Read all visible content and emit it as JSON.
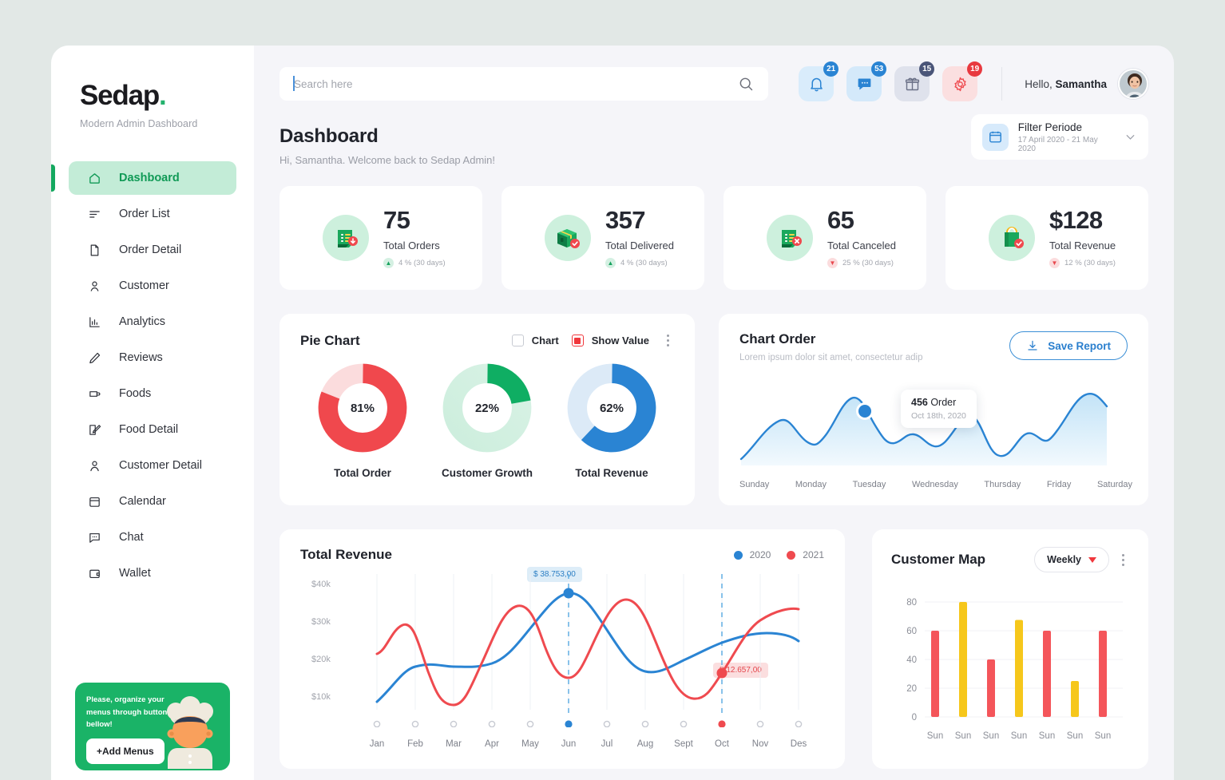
{
  "brand": {
    "name": "Sedap",
    "dot": ".",
    "subtitle": "Modern Admin Dashboard"
  },
  "sidebar": {
    "items": [
      {
        "label": "Dashboard",
        "icon": "home-icon",
        "active": true
      },
      {
        "label": "Order List",
        "icon": "list-icon",
        "active": false
      },
      {
        "label": "Order Detail",
        "icon": "file-icon",
        "active": false
      },
      {
        "label": "Customer",
        "icon": "user-icon",
        "active": false
      },
      {
        "label": "Analytics",
        "icon": "bar-chart-icon",
        "active": false
      },
      {
        "label": "Reviews",
        "icon": "pencil-icon",
        "active": false
      },
      {
        "label": "Foods",
        "icon": "cup-icon",
        "active": false
      },
      {
        "label": "Food Detail",
        "icon": "edit-square-icon",
        "active": false
      },
      {
        "label": "Customer Detail",
        "icon": "person-icon",
        "active": false
      },
      {
        "label": "Calendar",
        "icon": "calendar-icon",
        "active": false
      },
      {
        "label": "Chat",
        "icon": "chat-icon",
        "active": false
      },
      {
        "label": "Wallet",
        "icon": "wallet-icon",
        "active": false
      }
    ],
    "promo": {
      "text": "Please, organize your menus through button bellow!",
      "button": "+Add Menus"
    }
  },
  "topbar": {
    "search": {
      "placeholder": "Search here",
      "value": ""
    },
    "icons": [
      {
        "name": "bell-icon",
        "badge": "21"
      },
      {
        "name": "message-icon",
        "badge": "53"
      },
      {
        "name": "gift-icon",
        "badge": "15"
      },
      {
        "name": "gear-icon",
        "badge": "19"
      }
    ],
    "greeting_prefix": "Hello, ",
    "greeting_name": "Samantha"
  },
  "page": {
    "title": "Dashboard",
    "subtitle": "Hi, Samantha. Welcome back  to Sedap Admin!",
    "filter": {
      "label": "Filter Periode",
      "range": "17 April 2020 - 21 May 2020"
    }
  },
  "stats": [
    {
      "value": "75",
      "label": "Total Orders",
      "delta": "4 % (30 days)",
      "dir": "up",
      "icon": "order-doc-icon"
    },
    {
      "value": "357",
      "label": "Total Delivered",
      "delta": "4 % (30 days)",
      "dir": "up",
      "icon": "box-check-icon"
    },
    {
      "value": "65",
      "label": "Total Canceled",
      "delta": "25 % (30 days)",
      "dir": "down",
      "icon": "order-cancel-icon"
    },
    {
      "value": "$128",
      "label": "Total Revenue",
      "delta": "12 % (30 days)",
      "dir": "down",
      "icon": "bag-check-icon"
    }
  ],
  "pie_card": {
    "title": "Pie Chart",
    "controls": [
      {
        "label": "Chart",
        "checked": false
      },
      {
        "label": "Show Value",
        "checked": true
      }
    ]
  },
  "order_card": {
    "title": "Chart Order",
    "subtitle": "Lorem ipsum dolor sit amet, consectetur adip",
    "save_label": "Save Report",
    "tooltip": {
      "value": "456",
      "unit": " Order",
      "date": "Oct 18th, 2020"
    }
  },
  "revenue_card": {
    "title": "Total Revenue",
    "legend": [
      {
        "label": "2020",
        "color": "#2a84d3"
      },
      {
        "label": "2021",
        "color": "#ef4a4f"
      }
    ],
    "tooltip_blue": "$ 38.753,00",
    "tooltip_red": "$ 12.657,00"
  },
  "map_card": {
    "title": "Customer Map",
    "period": "Weekly"
  },
  "chart_data": [
    {
      "type": "pie",
      "title": "Pie Chart",
      "donuts": [
        {
          "label": "Total Order",
          "value": 81,
          "color": "#f0484d",
          "track": "#fbdcdd"
        },
        {
          "label": "Customer Growth",
          "value": 22,
          "color": "#0fae63",
          "track": "#d2efe0"
        },
        {
          "label": "Total Revenue",
          "value": 62,
          "color": "#2a84d3",
          "track": "#dceaf7"
        }
      ]
    },
    {
      "type": "area",
      "title": "Chart Order",
      "categories": [
        "Sunday",
        "Monday",
        "Tuesday",
        "Wednesday",
        "Thursday",
        "Friday",
        "Saturday"
      ],
      "values": [
        120,
        300,
        456,
        210,
        330,
        250,
        430
      ],
      "series": [
        {
          "name": "Orders",
          "values": [
            120,
            300,
            456,
            210,
            330,
            250,
            430
          ]
        }
      ],
      "xlabel": "",
      "ylabel": "",
      "annotation": {
        "x": "Tuesday",
        "value": 456,
        "text": "456 Order",
        "date": "Oct 18th, 2020"
      },
      "grid": false,
      "legend": "none"
    },
    {
      "type": "line",
      "title": "Total Revenue",
      "categories": [
        "Jan",
        "Feb",
        "Mar",
        "Apr",
        "May",
        "Jun",
        "Jul",
        "Aug",
        "Sept",
        "Oct",
        "Nov",
        "Des"
      ],
      "series": [
        {
          "name": "2020",
          "color": "#2a84d3",
          "values": [
            10000,
            17500,
            19000,
            18500,
            26000,
            38753,
            31000,
            20500,
            19500,
            22500,
            25500,
            25000
          ]
        },
        {
          "name": "2021",
          "color": "#ef4a4f",
          "values": [
            21000,
            29500,
            10000,
            24000,
            36000,
            19500,
            28000,
            38500,
            26000,
            12657,
            30500,
            38000
          ]
        }
      ],
      "ytick_labels": [
        "$40k",
        "$30k",
        "$20k",
        "$10k"
      ],
      "ylim": [
        0,
        45000
      ],
      "xlabel": "",
      "ylabel": "",
      "annotations": [
        {
          "series": "2020",
          "x": "Jun",
          "value": 38753,
          "text": "$ 38.753,00"
        },
        {
          "series": "2021",
          "x": "Oct",
          "value": 12657,
          "text": "$ 12.657,00"
        }
      ],
      "grid": true,
      "legend": "top-right"
    },
    {
      "type": "bar",
      "title": "Customer Map",
      "categories": [
        "Sun",
        "Sun",
        "Sun",
        "Sun",
        "Sun",
        "Sun",
        "Sun"
      ],
      "values": [
        60,
        80,
        40,
        68,
        60,
        25,
        60
      ],
      "colors": [
        "#f4555a",
        "#f6c71b",
        "#f4555a",
        "#f6c71b",
        "#f4555a",
        "#f6c71b",
        "#f4555a"
      ],
      "ytick_labels": [
        "0",
        "20",
        "40",
        "60",
        "80"
      ],
      "ylim": [
        0,
        88
      ],
      "xlabel": "",
      "ylabel": "",
      "grid": true,
      "legend": "none"
    }
  ]
}
